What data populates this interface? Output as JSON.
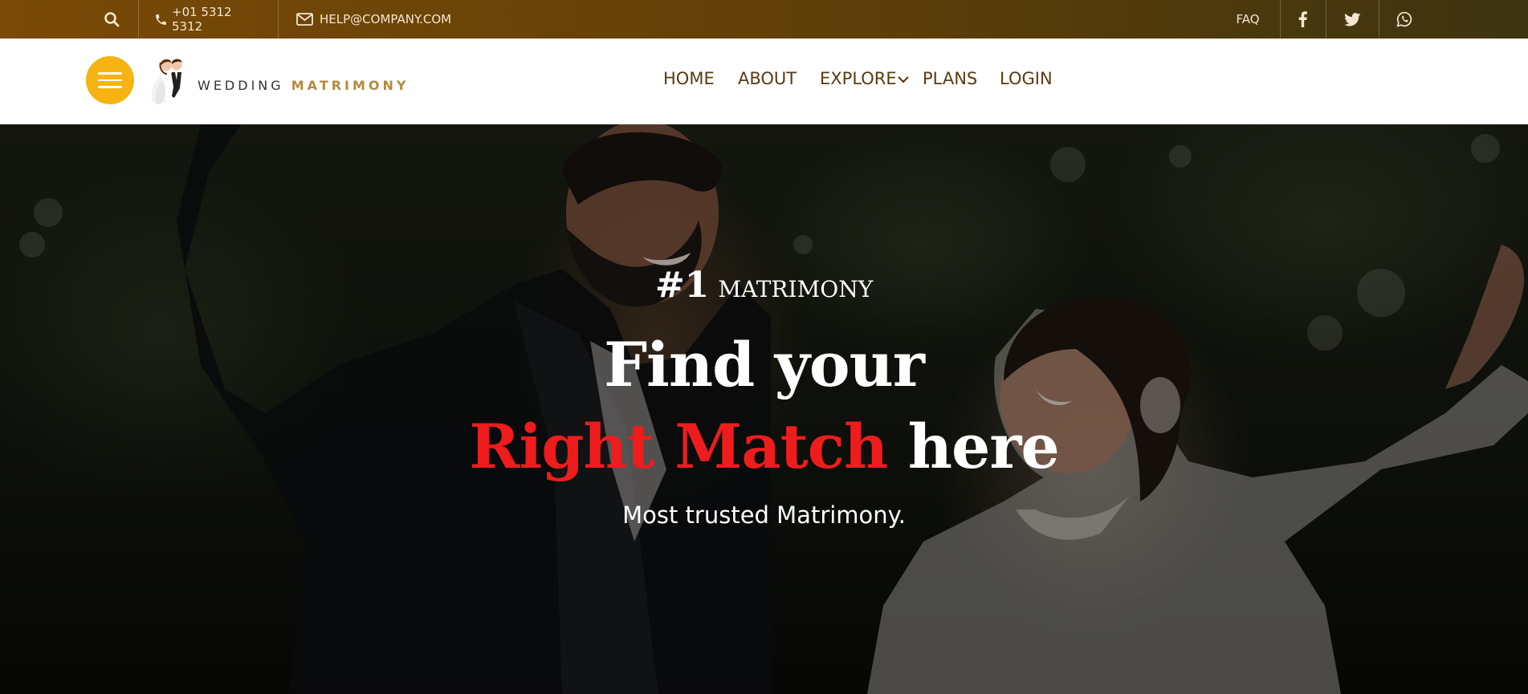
{
  "topbar": {
    "phone": "+01 5312 5312",
    "email": "HELP@COMPANY.COM",
    "faq": "FAQ",
    "icons": [
      "search-icon",
      "phone-icon",
      "mail-icon",
      "facebook-icon",
      "twitter-icon",
      "whatsapp-icon"
    ],
    "background": "#6b440a"
  },
  "logo": {
    "prefix": "WEDDING",
    "brand": "MATRIMONY",
    "brand_color": "#b58a3e"
  },
  "menu_button": {
    "icon": "hamburger-icon",
    "color": "#f5b412"
  },
  "nav": {
    "items": [
      "HOME",
      "ABOUT",
      "EXPLORE",
      "PLANS",
      "LOGIN"
    ],
    "dropdown_icon": "chevron-down-icon"
  },
  "hero": {
    "number": "#1",
    "label": "MATRIMONY",
    "line1": "Find your",
    "line2_accent": "Right Match",
    "line2_rest": "here",
    "subtitle": "Most trusted Matrimony.",
    "accent_color": "#ee1c1c"
  }
}
